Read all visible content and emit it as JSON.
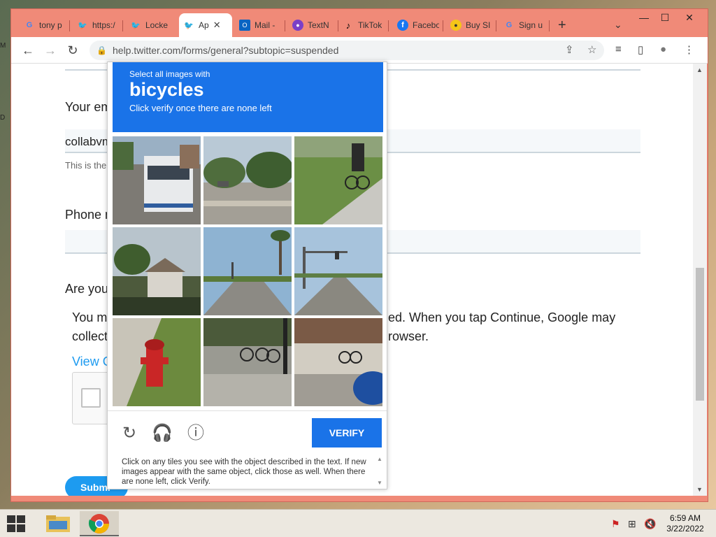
{
  "desktop": {
    "glyphs": [
      "M",
      "D"
    ]
  },
  "browser": {
    "tabs": [
      {
        "label": "tony p",
        "icon": "google-icon"
      },
      {
        "label": "https:/",
        "icon": "twitter-icon"
      },
      {
        "label": "Locke",
        "icon": "twitter-icon"
      },
      {
        "label": "Ap",
        "icon": "twitter-icon",
        "active": true
      },
      {
        "label": "Mail -",
        "icon": "outlook-icon"
      },
      {
        "label": "TextN",
        "icon": "textnow-icon"
      },
      {
        "label": "TikTok",
        "icon": "tiktok-icon"
      },
      {
        "label": "Facebo",
        "icon": "facebook-icon"
      },
      {
        "label": "Buy SI",
        "icon": "buy-icon"
      },
      {
        "label": "Sign u",
        "icon": "google-icon"
      }
    ],
    "tab_close": "✕",
    "new_tab": "+",
    "tab_search": "⌄",
    "window_controls": {
      "minimize": "—",
      "maximize": "☐",
      "close": "✕"
    },
    "nav": {
      "back": "←",
      "forward": "→",
      "reload": "↻"
    },
    "url": "help.twitter.com/forms/general?subtopic=suspended",
    "lock_icon": "🔒",
    "omni_icons": {
      "share": "⇪",
      "star": "☆"
    },
    "toolbar_icons": {
      "media": "≡",
      "sidepanel": "▯",
      "profile": "●",
      "menu": "⋮"
    }
  },
  "page": {
    "email_label": "Your em",
    "email_value": "collabvm",
    "email_helper": "This is the",
    "phone_label": "Phone n",
    "question_label": "Are you",
    "consent_line1_left": "You m",
    "consent_line1_right": "ed. When you tap Continue, Google may",
    "consent_line2_left": "collect",
    "consent_line2_right": "rowser.",
    "view_link": "View G",
    "submit_label": "Submi"
  },
  "captcha": {
    "instruction_small": "Select all images with",
    "target": "bicycles",
    "sub": "Click verify once there are none left",
    "tiles": [
      "bus-street",
      "intersection-trees",
      "cyclist-sidewalk",
      "palm-houses",
      "road-palms",
      "road-signals",
      "fire-hydrant",
      "bike-rack",
      "parked-bike-car"
    ],
    "reload_icon": "↻",
    "audio_icon": "🎧",
    "info_icon": "ⓘ",
    "verify_label": "VERIFY",
    "footer_text": "Click on any tiles you see with the object described in the text. If new images appear with the same object, click those as well. When there are none left, click Verify."
  },
  "taskbar": {
    "time": "6:59 AM",
    "date": "3/22/2022",
    "tray_icons": [
      "flag-icon",
      "network-icon",
      "volume-muted-icon"
    ]
  },
  "colors": {
    "chrome_frame": "#f08a78",
    "captcha_blue": "#1a73e8",
    "twitter_blue": "#1d9bf0"
  }
}
